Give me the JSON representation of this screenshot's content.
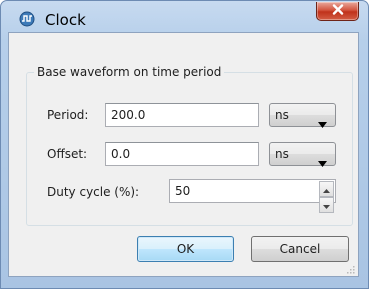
{
  "window": {
    "title": "Clock",
    "icon": "clock-wave-icon",
    "close_icon": "close-icon"
  },
  "group": {
    "title": "Base waveform on time period"
  },
  "period": {
    "label": "Period:",
    "value": "200.0",
    "unit": "ns"
  },
  "offset": {
    "label": "Offset:",
    "value": "0.0",
    "unit": "ns"
  },
  "duty": {
    "label": "Duty cycle (%):",
    "value": "50"
  },
  "buttons": {
    "ok": "OK",
    "cancel": "Cancel"
  },
  "colors": {
    "title_bar": "#b6cfea",
    "close_button": "#c7412a",
    "client_bg": "#f0f0f0",
    "ok_border": "#3c7fb1"
  }
}
